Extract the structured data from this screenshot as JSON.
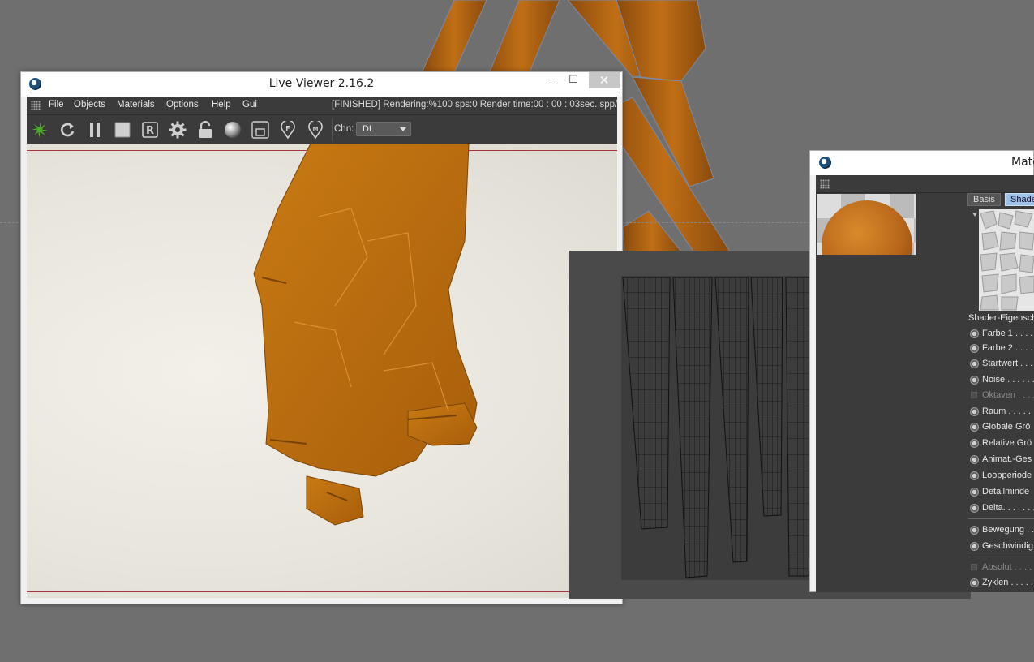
{
  "live_viewer": {
    "title": "Live Viewer 2.16.2",
    "window_controls": {
      "minimize": "—",
      "maximize": "☐",
      "close": "✕"
    },
    "menu": [
      "File",
      "Objects",
      "Materials",
      "Options",
      "Help",
      "Gui"
    ],
    "status": "[FINISHED]  Rendering:%100 sps:0 Render time:00 : 00 : 03sec. spp/m",
    "toolbar_icons": [
      "octane-logo-icon",
      "refresh-icon",
      "pause-icon",
      "stop-icon",
      "region-render-icon",
      "settings-gear-icon",
      "lock-icon",
      "material-ball-icon",
      "clay-mode-icon",
      "focus-pick-icon",
      "material-pick-icon"
    ],
    "toolbar_letters": {
      "region": "R",
      "focus": "F",
      "material": "M"
    },
    "channel_label": "Chn:",
    "channel_value": "DL"
  },
  "material_editor": {
    "title": "Mate",
    "tabs": [
      "Basis",
      "Shader"
    ],
    "section_title": "Shader-Eigensch",
    "properties": [
      {
        "label": "Farbe 1 . . . . .",
        "type": "radio"
      },
      {
        "label": "Farbe 2 . . . . .",
        "type": "radio"
      },
      {
        "label": "Startwert . . .",
        "type": "radio"
      },
      {
        "label": "Noise . . . . . .",
        "type": "radio"
      },
      {
        "label": "Oktaven . . . .",
        "type": "check",
        "disabled": true
      },
      {
        "label": "Raum . . . . . .",
        "type": "radio"
      },
      {
        "label": "Globale Grö",
        "type": "radio"
      },
      {
        "label": "Relative Grö",
        "type": "radio"
      },
      {
        "label": "Animat.-Ges",
        "type": "radio"
      },
      {
        "label": "Loopperiode",
        "type": "radio"
      },
      {
        "label": "Detailminde",
        "type": "radio"
      },
      {
        "label": "Delta. . . . . . .",
        "type": "radio"
      },
      {
        "label": "Bewegung . .",
        "type": "radio"
      },
      {
        "label": "Geschwindig",
        "type": "radio"
      },
      {
        "label": "Absolut . . . .",
        "type": "check",
        "disabled": true
      },
      {
        "label": "Zyklen . . . . .",
        "type": "radio"
      }
    ]
  },
  "colors": {
    "accent_orange": "#b86a12",
    "panel_dark": "#3b3b3b",
    "render_bg": "#e9e7df",
    "tab_active": "#9ec2e8",
    "octane_green": "#4caf2a"
  }
}
